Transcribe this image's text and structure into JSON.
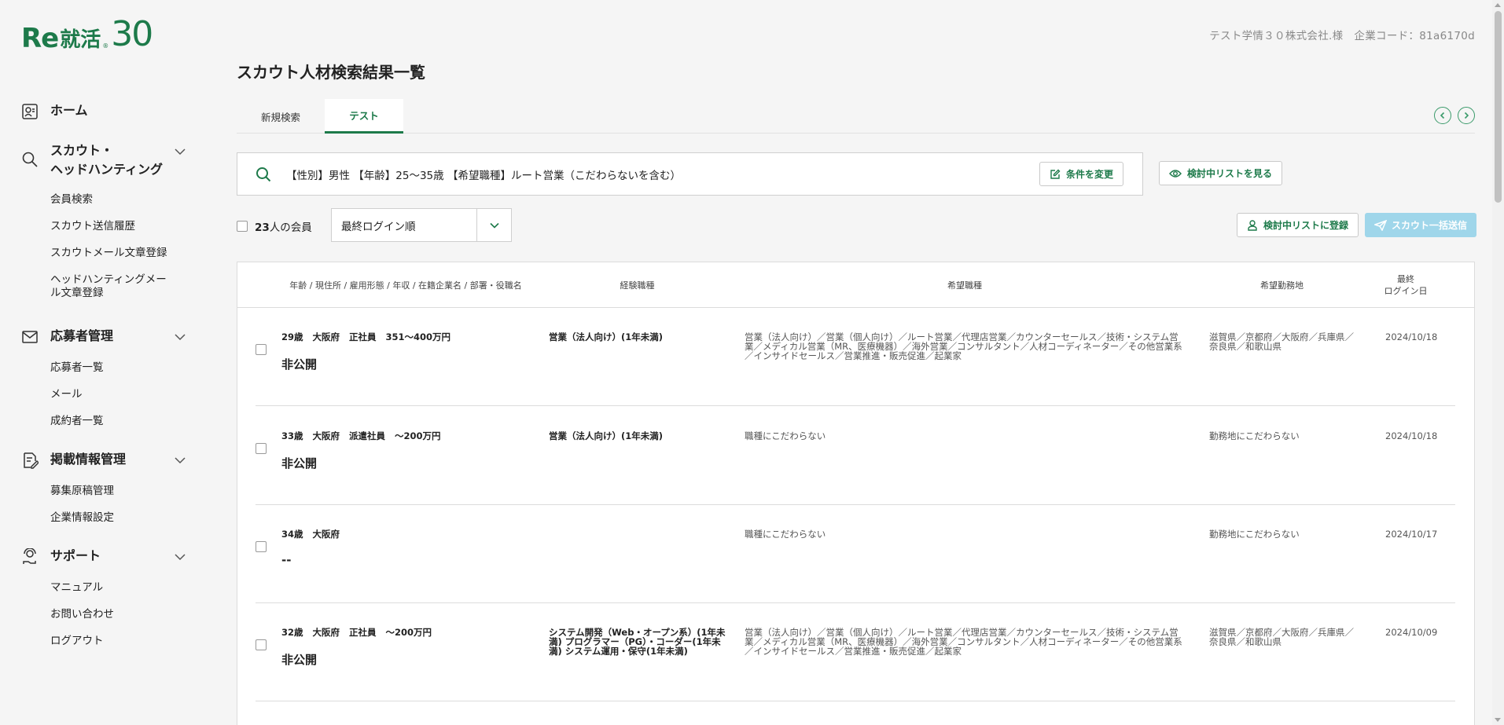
{
  "brand": {
    "logo_re": "Re",
    "logo_kanji": "就活",
    "logo_mark": "®",
    "logo_num": "30",
    "accent": "#1d7a4a"
  },
  "header": {
    "company_name": "テスト学情３０株式会社.様",
    "company_code": "企業コード：81a6170d"
  },
  "page_title": "スカウト人材検索結果一覧",
  "sidebar": {
    "home": {
      "label": "ホーム",
      "icon": "home-card-icon"
    },
    "scout": {
      "label_line1": "スカウト・",
      "label_line2": "ヘッドハンティング",
      "icon": "search-icon",
      "items": [
        "会員検索",
        "スカウト送信履歴",
        "スカウトメール文章登録",
        "ヘッドハンティングメール文章登録"
      ]
    },
    "applicants": {
      "label": "応募者管理",
      "icon": "mail-icon",
      "items": [
        "応募者一覧",
        "メール",
        "成約者一覧"
      ]
    },
    "postings": {
      "label": "掲載情報管理",
      "icon": "edit-document-icon",
      "items": [
        "募集原稿管理",
        "企業情報設定"
      ]
    },
    "support": {
      "label": "サポート",
      "icon": "support-icon",
      "items": [
        "マニュアル",
        "お問い合わせ",
        "ログアウト"
      ]
    }
  },
  "tabs": [
    {
      "label": "新規検索",
      "active": false
    },
    {
      "label": "テスト",
      "active": true
    }
  ],
  "search": {
    "query": "【性別】男性 【年齢】25〜35歳 【希望職種】ルート営業（こだわらないを含む）",
    "change_label": "条件を変更",
    "watchlist_label": "検討中リストを見る"
  },
  "controls": {
    "member_count": "23",
    "member_suffix": "人の会員",
    "sort_value": "最終ログイン順",
    "register_label": "検討中リストに登録",
    "scout_label": "スカウト一括送信",
    "scout_color": "#9fd6ea"
  },
  "table": {
    "headers": {
      "profile": "年齢 / 現住所 / 雇用形態 / 年収 / 在籍企業名 / 部署・役職名",
      "experience": "経験職種",
      "desired_job": "希望職種",
      "desired_area": "希望勤務地",
      "last_login_line1": "最終",
      "last_login_line2": "ログイン日"
    },
    "rows": [
      {
        "age": "29歳",
        "location": "大阪府",
        "employment": "正社員",
        "income": "351〜400万円",
        "company": "非公開",
        "experience": "営業（法人向け）(1年未満)",
        "desired_job": "営業（法人向け）／営業（個人向け）／ルート営業／代理店営業／カウンターセールス／技術・システム営業／メディカル営業（MR、医療機器）／海外営業／コンサルタント／人材コーディネーター／その他営業系／インサイドセールス／営業推進・販売促進／起業家",
        "desired_area": "滋賀県／京都府／大阪府／兵庫県／奈良県／和歌山県",
        "last_login": "2024/10/18"
      },
      {
        "age": "33歳",
        "location": "大阪府",
        "employment": "派遣社員",
        "income": "〜200万円",
        "company": "非公開",
        "experience": "営業（法人向け）(1年未満)",
        "desired_job": "職種にこだわらない",
        "desired_area": "勤務地にこだわらない",
        "last_login": "2024/10/18"
      },
      {
        "age": "34歳",
        "location": "大阪府",
        "employment": "",
        "income": "",
        "company": "--",
        "experience": "",
        "desired_job": "職種にこだわらない",
        "desired_area": "勤務地にこだわらない",
        "last_login": "2024/10/17"
      },
      {
        "age": "32歳",
        "location": "大阪府",
        "employment": "正社員",
        "income": "〜200万円",
        "company": "非公開",
        "experience": "システム開発（Web・オープン系）(1年未満) プログラマー（PG）・コーダー(1年未満) システム運用・保守(1年未満)",
        "desired_job": "営業（法人向け）／営業（個人向け）／ルート営業／代理店営業／カウンターセールス／技術・システム営業／メディカル営業（MR、医療機器）／海外営業／コンサルタント／人材コーディネーター／その他営業系／インサイドセールス／営業推進・販売促進／起業家",
        "desired_area": "滋賀県／京都府／大阪府／兵庫県／奈良県／和歌山県",
        "last_login": "2024/10/09"
      }
    ]
  }
}
